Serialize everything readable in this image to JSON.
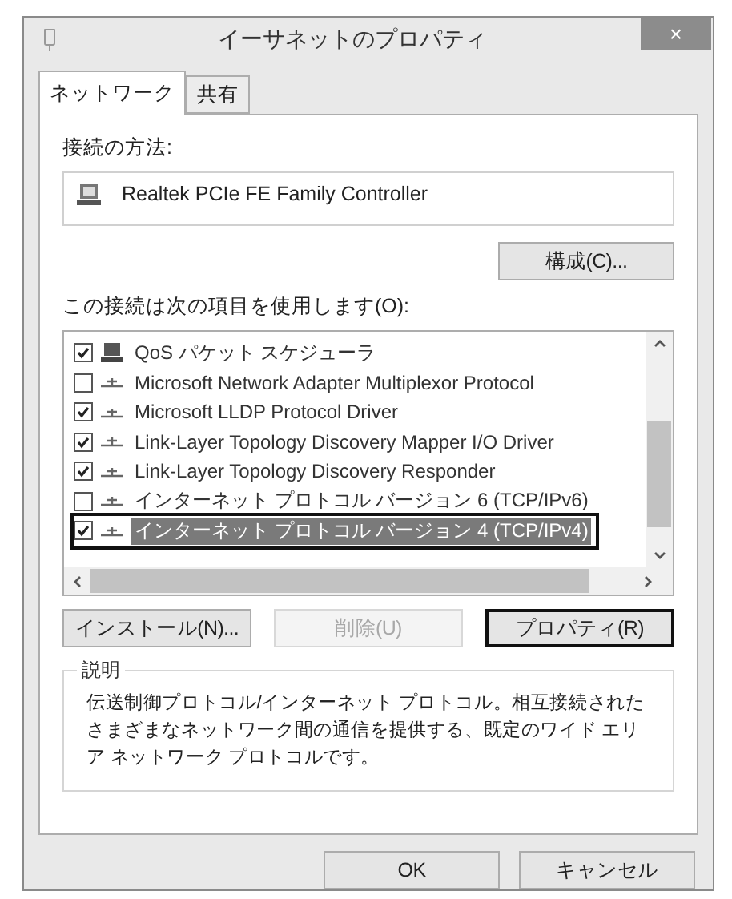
{
  "window": {
    "title": "イーサネットのプロパティ",
    "close": "×"
  },
  "tabs": [
    {
      "label": "ネットワーク",
      "selected": true
    },
    {
      "label": "共有",
      "selected": false
    }
  ],
  "connect_using": {
    "label": "接続の方法:",
    "adapter": "Realtek PCIe FE Family Controller"
  },
  "configure_button": "構成(C)...",
  "items_label": "この接続は次の項目を使用します(O):",
  "items": [
    {
      "kind": "scheduler",
      "label": "QoS パケット スケジューラ",
      "checked": true,
      "selected": false
    },
    {
      "kind": "protocol",
      "label": "Microsoft Network Adapter Multiplexor Protocol",
      "checked": false,
      "selected": false
    },
    {
      "kind": "protocol",
      "label": "Microsoft LLDP Protocol Driver",
      "checked": true,
      "selected": false
    },
    {
      "kind": "protocol",
      "label": "Link-Layer Topology Discovery Mapper I/O Driver",
      "checked": true,
      "selected": false
    },
    {
      "kind": "protocol",
      "label": "Link-Layer Topology Discovery Responder",
      "checked": true,
      "selected": false
    },
    {
      "kind": "protocol",
      "label": "インターネット プロトコル バージョン 6 (TCP/IPv6)",
      "checked": false,
      "selected": false
    },
    {
      "kind": "protocol",
      "label": "インターネット プロトコル バージョン 4 (TCP/IPv4)",
      "checked": true,
      "selected": true
    }
  ],
  "item_buttons": [
    {
      "label": "インストール(N)...",
      "disabled": false,
      "focused": false
    },
    {
      "label": "削除(U)",
      "disabled": true,
      "focused": false
    },
    {
      "label": "プロパティ(R)",
      "disabled": false,
      "focused": true
    }
  ],
  "description": {
    "title": "説明",
    "text": "伝送制御プロトコル/インターネット プロトコル。相互接続されたさまざまなネットワーク間の通信を提供する、既定のワイド エリア ネットワーク プロトコルです。"
  },
  "footer_buttons": [
    "OK",
    "キャンセル"
  ]
}
